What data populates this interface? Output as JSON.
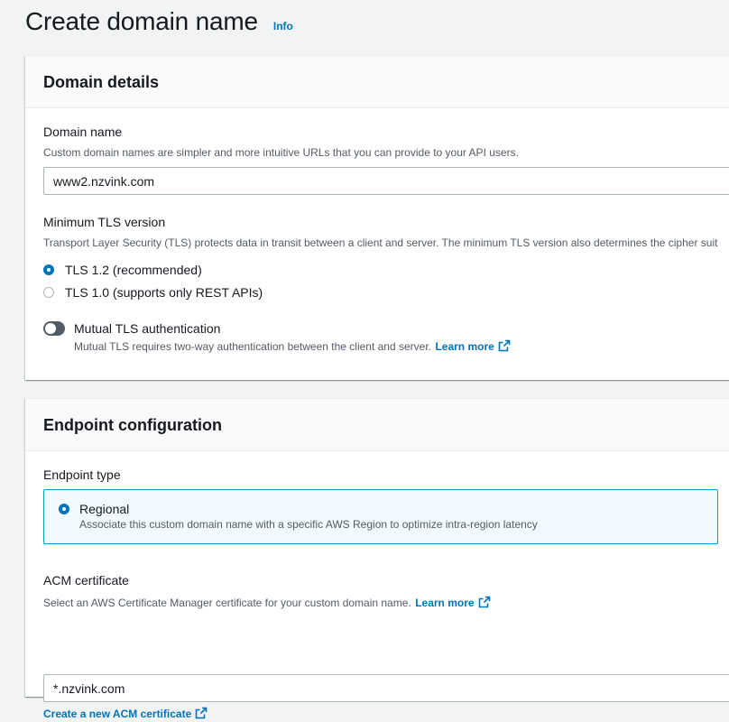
{
  "header": {
    "title": "Create domain name",
    "info": "Info"
  },
  "domain_details": {
    "title": "Domain details",
    "domain_name": {
      "label": "Domain name",
      "description": "Custom domain names are simpler and more intuitive URLs that you can provide to your API users.",
      "value": "www2.nzvink.com"
    },
    "tls": {
      "label": "Minimum TLS version",
      "description": "Transport Layer Security (TLS) protects data in transit between a client and server. The minimum TLS version also determines the cipher suit",
      "options": [
        {
          "label": "TLS 1.2 (recommended)",
          "checked": true
        },
        {
          "label": "TLS 1.0 (supports only REST APIs)",
          "checked": false
        }
      ]
    },
    "mutual_tls": {
      "label": "Mutual TLS authentication",
      "description": "Mutual TLS requires two-way authentication between the client and server.",
      "learn_more": "Learn more",
      "enabled": false
    }
  },
  "endpoint_configuration": {
    "title": "Endpoint configuration",
    "endpoint_type": {
      "label": "Endpoint type",
      "option_label": "Regional",
      "option_description": "Associate this custom domain name with a specific AWS Region to optimize intra-region latency",
      "checked": true
    },
    "acm": {
      "label": "ACM certificate",
      "description": "Select an AWS Certificate Manager certificate for your custom domain name.",
      "learn_more": "Learn more",
      "value": "*.nzvink.com",
      "create_link": "Create a new ACM certificate"
    }
  },
  "colors": {
    "link": "#0073bb",
    "tile_border": "#00a1c9",
    "tile_bg": "#f1faff",
    "toggle_off": "#545b64"
  },
  "icons": {
    "external": "external-link-icon"
  }
}
